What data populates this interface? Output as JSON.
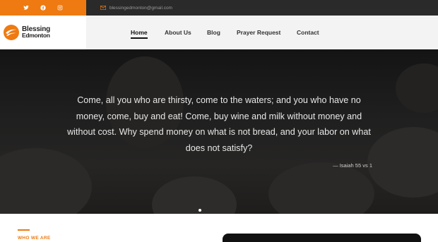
{
  "topbar": {
    "socials": [
      {
        "icon": "twitter-icon"
      },
      {
        "icon": "facebook-icon"
      },
      {
        "icon": "instagram-icon"
      }
    ],
    "email": "blessingedmonton@gmail.com",
    "accent_color": "#ee7a11"
  },
  "header": {
    "logo_line1": "Blessing",
    "logo_line2": "Edmonton",
    "nav": [
      {
        "label": "Home",
        "active": true
      },
      {
        "label": "About Us"
      },
      {
        "label": "Blog"
      },
      {
        "label": "Prayer Request"
      },
      {
        "label": "Contact"
      }
    ]
  },
  "hero": {
    "quote": "Come, all you who are thirsty, come to the waters; and you who have no money, come, buy and eat! Come, buy wine and milk without money and without cost. Why spend money on what is not bread, and your labor on what does not satisfy?",
    "citation": "— Isaiah 55 vs 1"
  },
  "section": {
    "who_label": "WHO WE ARE"
  }
}
